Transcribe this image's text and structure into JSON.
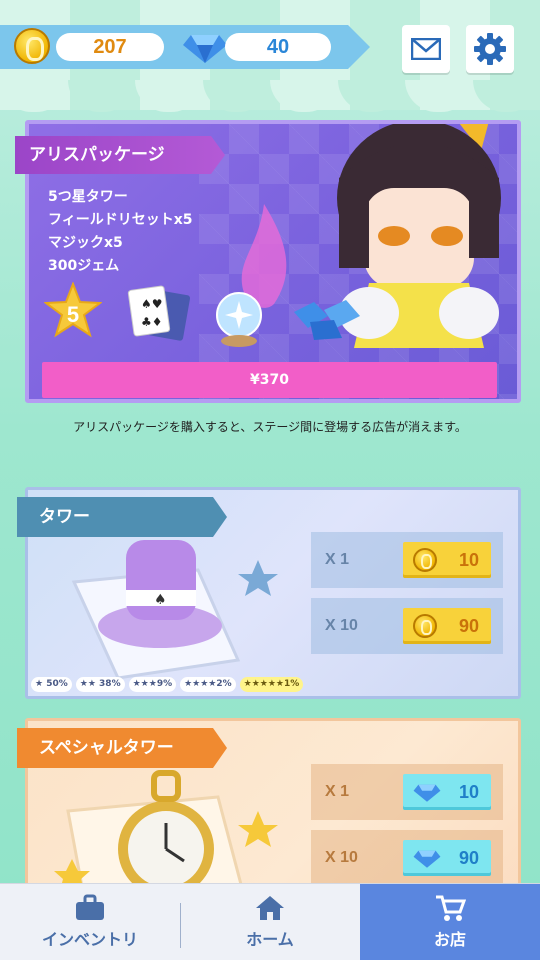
{
  "currency": {
    "coins": "207",
    "gems": "40"
  },
  "header_buttons": {
    "mail": "mail-icon",
    "settings": "gear-icon"
  },
  "package": {
    "title": "アリスパッケージ",
    "items": [
      "5つ星タワー",
      "フィールドリセットx5",
      "マジックx5",
      "300ジェム"
    ],
    "star_rank": "5",
    "price": "¥370",
    "note": "アリスパッケージを購入すると、ステージ間に登場する広告が消えます。"
  },
  "tower_gacha": {
    "title": "タワー",
    "options": [
      {
        "qty": "X 1",
        "price": "10",
        "currency": "coin"
      },
      {
        "qty": "X 10",
        "price": "90",
        "currency": "coin"
      }
    ],
    "odds": [
      {
        "stars": "★",
        "rate": "50%"
      },
      {
        "stars": "★★",
        "rate": "38%"
      },
      {
        "stars": "★★★",
        "rate": "9%"
      },
      {
        "stars": "★★★★",
        "rate": "2%"
      },
      {
        "stars": "★★★★★",
        "rate": "1%"
      }
    ]
  },
  "special_gacha": {
    "title": "スペシャルタワー",
    "options": [
      {
        "qty": "X 1",
        "price": "10",
        "currency": "gem"
      },
      {
        "qty": "X 10",
        "price": "90",
        "currency": "gem"
      }
    ]
  },
  "nav": {
    "items": [
      {
        "label": "インベントリ",
        "icon": "briefcase-icon"
      },
      {
        "label": "ホーム",
        "icon": "home-icon"
      },
      {
        "label": "お店",
        "icon": "cart-icon"
      }
    ],
    "active_index": 2
  },
  "colors": {
    "accent_pink": "#f25ec8",
    "package_purple": "#7b63de",
    "nav_active": "#5a86df"
  }
}
